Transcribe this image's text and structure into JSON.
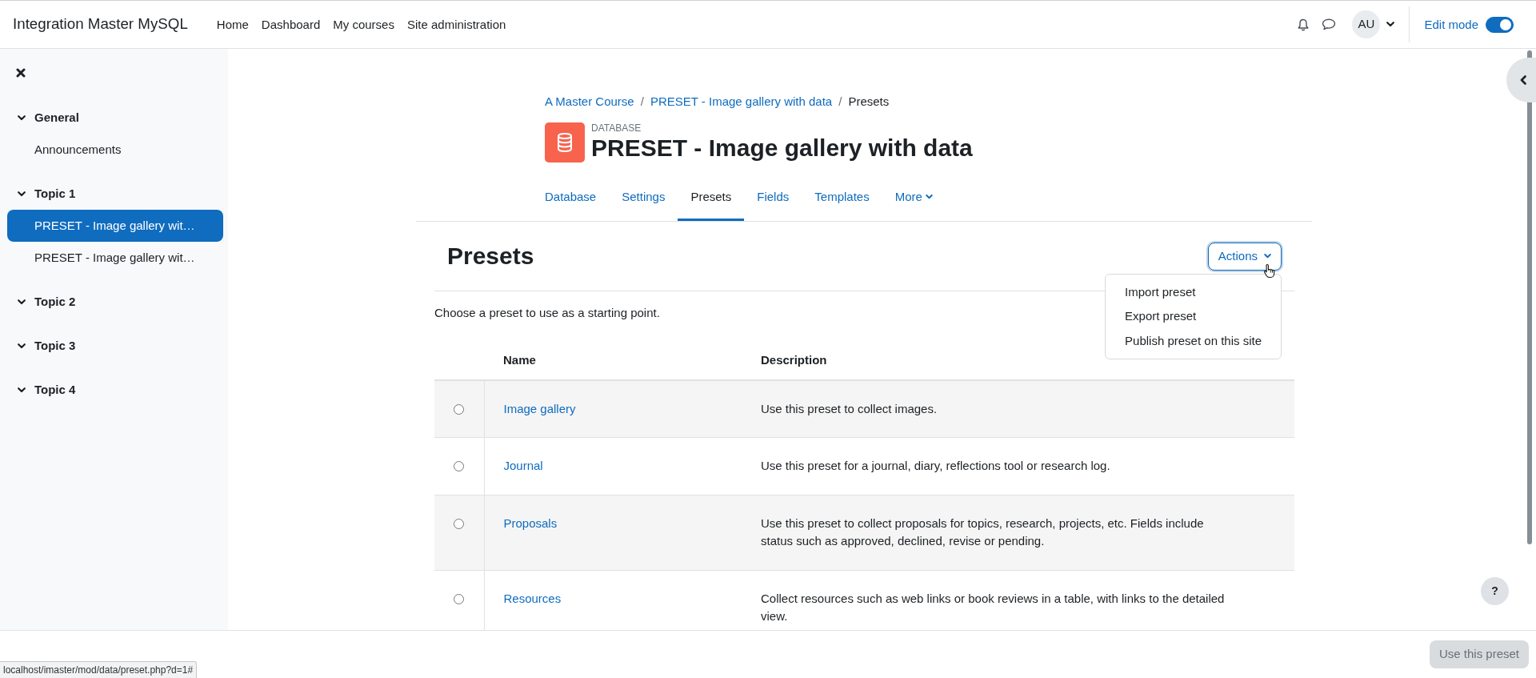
{
  "navbar": {
    "site_name": "Integration Master MySQL",
    "links": [
      {
        "label": "Home"
      },
      {
        "label": "Dashboard"
      },
      {
        "label": "My courses"
      },
      {
        "label": "Site administration"
      }
    ],
    "user_initials": "AU",
    "edit_mode": {
      "label": "Edit mode",
      "on": true
    }
  },
  "course_index": {
    "sections": [
      {
        "title": "General",
        "expanded": true,
        "items": [
          {
            "label": "Announcements",
            "selected": false
          }
        ]
      },
      {
        "title": "Topic 1",
        "expanded": true,
        "items": [
          {
            "label": "PRESET - Image gallery wit…",
            "selected": true
          },
          {
            "label": "PRESET - Image gallery wit…",
            "selected": false
          }
        ]
      },
      {
        "title": "Topic 2",
        "expanded": true
      },
      {
        "title": "Topic 3",
        "expanded": true
      },
      {
        "title": "Topic 4",
        "expanded": true
      }
    ]
  },
  "breadcrumb": {
    "separator": "/",
    "items": [
      {
        "label": "A Master Course",
        "kind": "link"
      },
      {
        "label": "PRESET - Image gallery with data",
        "kind": "link"
      },
      {
        "label": "Presets",
        "kind": "current"
      }
    ]
  },
  "activity_header": {
    "type_label": "DATABASE",
    "title": "PRESET - Image gallery with data"
  },
  "tabs": [
    {
      "label": "Database",
      "selected": false,
      "kind": "link"
    },
    {
      "label": "Settings",
      "selected": false,
      "kind": "link"
    },
    {
      "label": "Presets",
      "selected": true,
      "kind": "link"
    },
    {
      "label": "Fields",
      "selected": false,
      "kind": "link"
    },
    {
      "label": "Templates",
      "selected": false,
      "kind": "link"
    },
    {
      "label": "More",
      "selected": false,
      "kind": "menu"
    }
  ],
  "presets": {
    "heading": "Presets",
    "actions": {
      "label": "Actions",
      "expanded": true,
      "menu": [
        {
          "label": "Import preset"
        },
        {
          "label": "Export preset"
        },
        {
          "label": "Publish preset on this site"
        }
      ]
    },
    "intro": "Choose a preset to use as a starting point.",
    "table": {
      "columns": [
        "Name",
        "Description"
      ],
      "rows": [
        {
          "selected": false,
          "name": "Image gallery",
          "description": "Use this preset to collect images."
        },
        {
          "selected": false,
          "name": "Journal",
          "description": "Use this preset for a journal, diary, reflections tool or research log."
        },
        {
          "selected": false,
          "name": "Proposals",
          "description": "Use this preset to collect proposals for topics, research, projects, etc. Fields include status such as approved, declined, revise or pending."
        },
        {
          "selected": false,
          "name": "Resources",
          "description": "Collect resources such as web links or book reviews in a table, with links to the detailed view."
        }
      ]
    }
  },
  "footer": {
    "button": {
      "label": "Use this preset",
      "disabled": true
    }
  },
  "help_button": {
    "label": "?"
  },
  "status_url": "localhost/imaster/mod/data/preset.php?d=1#"
}
